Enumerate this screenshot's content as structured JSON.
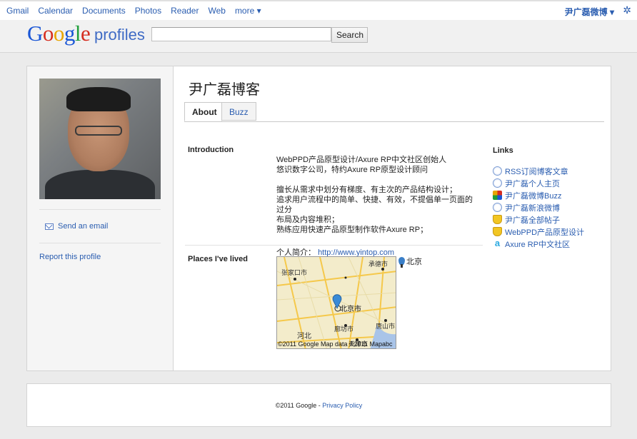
{
  "topbar": {
    "nav": [
      "Gmail",
      "Calendar",
      "Documents",
      "Photos",
      "Reader",
      "Web"
    ],
    "more": "more ▾",
    "user": "尹广磊微博 ▾",
    "settings_icon": "gear-icon"
  },
  "header": {
    "logo_letters": [
      "G",
      "o",
      "o",
      "g",
      "l",
      "e"
    ],
    "logo_sub": "profiles",
    "search_placeholder": "",
    "search_button": "Search"
  },
  "sidebar": {
    "send_email": "Send an email",
    "report": "Report this profile"
  },
  "profile": {
    "name": "尹广磊博客",
    "tabs": [
      "About",
      "Buzz"
    ],
    "introduction_label": "Introduction",
    "introduction_lines": [
      "WebPPD产品原型设计/Axure RP中文社区创始人",
      "悠识数字公司，特约Axure RP原型设计顾问",
      "",
      "擅长从需求中划分有梯度、有主次的产品结构设计；",
      "追求用户流程中的简单、快捷、有效，不提倡单一页面的过分",
      "布局及内容堆积；",
      "熟练应用快速产品原型制作软件Axure RP；"
    ],
    "homepage_label": "个人简介：",
    "homepage_url": "http://www.yintop.com",
    "places_label": "Places I've lived",
    "place": "北京",
    "map_caption": "©2011 Google Map data ©2011 Mapabc",
    "map_labels": [
      "张家口市",
      "承德市",
      "北京市",
      "廊坊市",
      "唐山市",
      "河北",
      "天津市"
    ],
    "links_label": "Links",
    "links": [
      {
        "text": "RSS订阅博客文章",
        "icon": "globe-icon"
      },
      {
        "text": "尹广磊个人主页",
        "icon": "globe-icon"
      },
      {
        "text": "尹广磊微博Buzz",
        "icon": "google-icon"
      },
      {
        "text": "尹广磊新浪微博",
        "icon": "globe-icon"
      },
      {
        "text": "尹广磊全部帖子",
        "icon": "trophy-icon"
      },
      {
        "text": "WebPPD产品原型设计",
        "icon": "trophy-icon"
      },
      {
        "text": "Axure RP中文社区",
        "icon": "axure-icon"
      }
    ]
  },
  "footer": {
    "copyright": "©2011 Google - ",
    "privacy": "Privacy Policy"
  }
}
